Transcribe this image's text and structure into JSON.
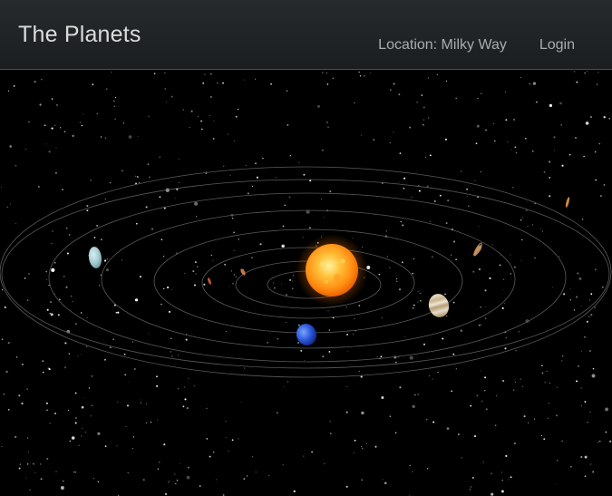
{
  "navbar": {
    "title": "The Planets",
    "location_label": "Location: Milky Way",
    "login_label": "Login"
  },
  "colors": {
    "navbar_bg": "#23272a",
    "title_text": "#dcdcdc",
    "nav_text": "#a9acaf",
    "orbit_line": "#5a5a5a",
    "sun_core": "#ffd24a",
    "sun_edge": "#ff7a00"
  },
  "scene": {
    "background": "starfield",
    "center_body": "sun",
    "orbit_count": 8,
    "planets": [
      "mercury",
      "venus",
      "earth",
      "mars",
      "jupiter",
      "saturn",
      "uranus",
      "neptune"
    ]
  }
}
